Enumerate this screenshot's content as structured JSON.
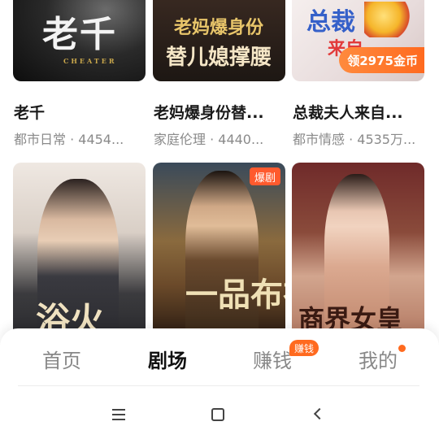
{
  "cards": [
    {
      "title": "老千",
      "meta": "都市日常 · 4454...",
      "cover_text": "老千",
      "cover_sub": "CHEATER"
    },
    {
      "title": "老妈爆身份替...",
      "meta": "家庭伦理 · 4440...",
      "cover_text_top": "老妈爆身份",
      "cover_text_bottom": "替儿媳撑腰"
    },
    {
      "title": "总裁夫人来自...",
      "meta": "都市情感 · 4535万...",
      "cover_text": "总裁",
      "cover_text2": "来自",
      "reward_label": "领2975金币"
    },
    {
      "cover_text": "浴火"
    },
    {
      "badge": "爆剧",
      "cover_text": "一品布衣"
    },
    {
      "cover_text": "商界女皇"
    }
  ],
  "nav": {
    "tabs": [
      "首页",
      "剧场",
      "赚钱",
      "我的"
    ],
    "active_tab": "剧场",
    "earn_badge": "赚钱"
  },
  "colors": {
    "accent": "#ff6a1f",
    "text_primary": "#1a1a1a",
    "text_secondary": "#8a8a8a"
  },
  "icons": [
    "menu-icon",
    "home-icon",
    "back-icon"
  ]
}
